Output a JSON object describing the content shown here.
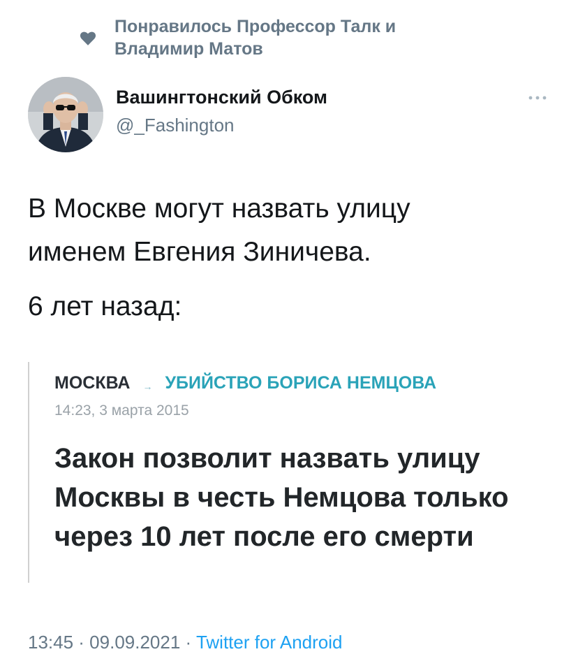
{
  "social_context": {
    "text": "Понравилось Профессор Талк и Владимир Матов",
    "icon": "heart-icon"
  },
  "author": {
    "name": "Вашингтонский Обком",
    "handle": "@_Fashington",
    "avatar": "avatar-photo"
  },
  "tweet": {
    "line1": "В Москве могут назвать улицу",
    "line2": "именем Евгения Зиничева.",
    "line3": "6 лет назад:"
  },
  "quote": {
    "section": "МОСКВА",
    "arrow": "→",
    "topic": "УБИЙСТВО БОРИСА НЕМЦОВА",
    "date": "14:23, 3 марта 2015",
    "headline": "Закон позволит назвать улицу Москвы в честь Немцова только через 10 лет после его смерти"
  },
  "meta": {
    "time_date": "13:45 · 09.09.2021 · ",
    "source": "Twitter for Android"
  },
  "colors": {
    "text_primary": "#14171a",
    "text_secondary": "#657786",
    "link": "#1da1f2",
    "topic": "#2aa3b8"
  }
}
